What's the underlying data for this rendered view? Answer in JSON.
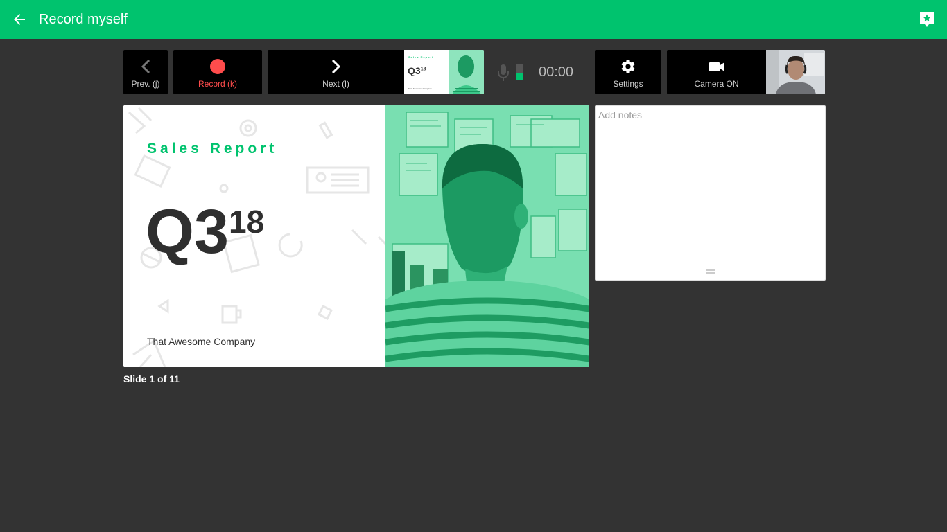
{
  "header": {
    "title": "Record myself",
    "back_icon": "arrow-left-icon",
    "help_icon": "star-badge-icon",
    "bar_color": "#00c36e"
  },
  "toolbar": {
    "prev_label": "Prev. (j)",
    "record_label": "Record (k)",
    "next_label": "Next (l)",
    "settings_label": "Settings",
    "camera_label": "Camera ON",
    "timer": "00:00",
    "record_color": "#ff4c4c",
    "mic_level": 0.4
  },
  "next_thumb": {
    "title": "Sales Report",
    "q": "Q3",
    "sup": "18",
    "company": "That Awesome Company"
  },
  "slide": {
    "title": "Sales Report",
    "q": "Q3",
    "sup": "18",
    "company": "That Awesome Company",
    "accent": "#00c36e"
  },
  "slide_counter": "Slide 1 of 11",
  "notes": {
    "placeholder": "Add notes",
    "value": ""
  }
}
